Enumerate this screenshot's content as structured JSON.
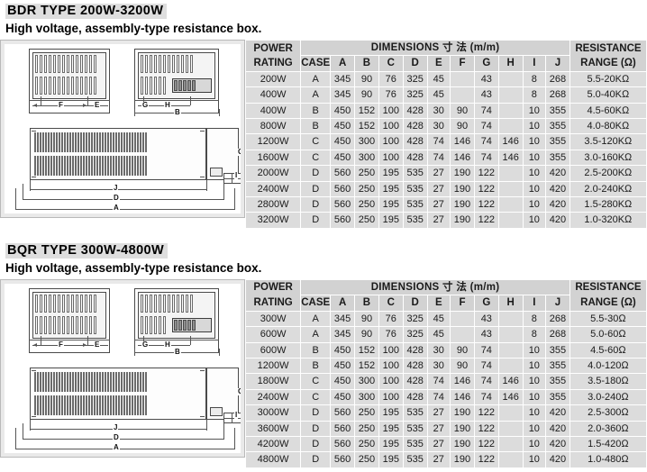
{
  "sections": [
    {
      "title": "BDR TYPE 200W-3200W",
      "subtitle": "High voltage, assembly-type resistance box.",
      "drawing": {
        "labels": {
          "f": "F",
          "e": "E",
          "g": "G",
          "h": "H",
          "b": "B",
          "j": "J",
          "d": "D",
          "a": "A",
          "c": "C",
          "i": "I"
        }
      },
      "table": {
        "header": {
          "power_rating": "POWER RATING",
          "power_rating_l1": "POWER",
          "power_rating_l2": "RATING",
          "dimensions": "DIMENSIONS 寸  法 (m/m)",
          "resistance": "RESISTANCE RANGE (Ω)",
          "resistance_l1": "RESISTANCE",
          "resistance_l2": "RANGE (Ω)",
          "columns": [
            "CASE",
            "A",
            "B",
            "C",
            "D",
            "E",
            "F",
            "G",
            "H",
            "I",
            "J"
          ]
        },
        "rows": [
          {
            "power": "200W",
            "case": "A",
            "a": "345",
            "b": "90",
            "c": "76",
            "d": "325",
            "e": "45",
            "f": "",
            "g": "43",
            "h": "",
            "i": "8",
            "j": "268",
            "res": "5.5-20KΩ"
          },
          {
            "power": "400W",
            "case": "A",
            "a": "345",
            "b": "90",
            "c": "76",
            "d": "325",
            "e": "45",
            "f": "",
            "g": "43",
            "h": "",
            "i": "8",
            "j": "268",
            "res": "5.0-40KΩ"
          },
          {
            "power": "400W",
            "case": "B",
            "a": "450",
            "b": "152",
            "c": "100",
            "d": "428",
            "e": "30",
            "f": "90",
            "g": "74",
            "h": "",
            "i": "10",
            "j": "355",
            "res": "4.5-60KΩ"
          },
          {
            "power": "800W",
            "case": "B",
            "a": "450",
            "b": "152",
            "c": "100",
            "d": "428",
            "e": "30",
            "f": "90",
            "g": "74",
            "h": "",
            "i": "10",
            "j": "355",
            "res": "4.0-80KΩ"
          },
          {
            "power": "1200W",
            "case": "C",
            "a": "450",
            "b": "300",
            "c": "100",
            "d": "428",
            "e": "74",
            "f": "146",
            "g": "74",
            "h": "146",
            "i": "10",
            "j": "355",
            "res": "3.5-120KΩ"
          },
          {
            "power": "1600W",
            "case": "C",
            "a": "450",
            "b": "300",
            "c": "100",
            "d": "428",
            "e": "74",
            "f": "146",
            "g": "74",
            "h": "146",
            "i": "10",
            "j": "355",
            "res": "3.0-160KΩ"
          },
          {
            "power": "2000W",
            "case": "D",
            "a": "560",
            "b": "250",
            "c": "195",
            "d": "535",
            "e": "27",
            "f": "190",
            "g": "122",
            "h": "",
            "i": "10",
            "j": "420",
            "res": "2.5-200KΩ"
          },
          {
            "power": "2400W",
            "case": "D",
            "a": "560",
            "b": "250",
            "c": "195",
            "d": "535",
            "e": "27",
            "f": "190",
            "g": "122",
            "h": "",
            "i": "10",
            "j": "420",
            "res": "2.0-240KΩ"
          },
          {
            "power": "2800W",
            "case": "D",
            "a": "560",
            "b": "250",
            "c": "195",
            "d": "535",
            "e": "27",
            "f": "190",
            "g": "122",
            "h": "",
            "i": "10",
            "j": "420",
            "res": "1.5-280KΩ"
          },
          {
            "power": "3200W",
            "case": "D",
            "a": "560",
            "b": "250",
            "c": "195",
            "d": "535",
            "e": "27",
            "f": "190",
            "g": "122",
            "h": "",
            "i": "10",
            "j": "420",
            "res": "1.0-320KΩ"
          }
        ]
      }
    },
    {
      "title": "BQR TYPE 300W-4800W",
      "subtitle": "High voltage, assembly-type resistance box.",
      "drawing": {
        "labels": {
          "f": "F",
          "e": "E",
          "g": "G",
          "h": "H",
          "b": "B",
          "j": "J",
          "d": "D",
          "a": "A",
          "c": "C",
          "i": "I"
        }
      },
      "table": {
        "header": {
          "power_rating": "POWER RATING",
          "power_rating_l1": "POWER",
          "power_rating_l2": "RATING",
          "dimensions": "DIMENSIONS 寸  法 (m/m)",
          "resistance": "RESISTANCE RANGE (Ω)",
          "resistance_l1": "RESISTANCE",
          "resistance_l2": "RANGE (Ω)",
          "columns": [
            "CASE",
            "A",
            "B",
            "C",
            "D",
            "E",
            "F",
            "G",
            "H",
            "I",
            "J"
          ]
        },
        "rows": [
          {
            "power": "300W",
            "case": "A",
            "a": "345",
            "b": "90",
            "c": "76",
            "d": "325",
            "e": "45",
            "f": "",
            "g": "43",
            "h": "",
            "i": "8",
            "j": "268",
            "res": "5.5-30Ω"
          },
          {
            "power": "600W",
            "case": "A",
            "a": "345",
            "b": "90",
            "c": "76",
            "d": "325",
            "e": "45",
            "f": "",
            "g": "43",
            "h": "",
            "i": "8",
            "j": "268",
            "res": "5.0-60Ω"
          },
          {
            "power": "600W",
            "case": "B",
            "a": "450",
            "b": "152",
            "c": "100",
            "d": "428",
            "e": "30",
            "f": "90",
            "g": "74",
            "h": "",
            "i": "10",
            "j": "355",
            "res": "4.5-60Ω"
          },
          {
            "power": "1200W",
            "case": "B",
            "a": "450",
            "b": "152",
            "c": "100",
            "d": "428",
            "e": "30",
            "f": "90",
            "g": "74",
            "h": "",
            "i": "10",
            "j": "355",
            "res": "4.0-120Ω"
          },
          {
            "power": "1800W",
            "case": "C",
            "a": "450",
            "b": "300",
            "c": "100",
            "d": "428",
            "e": "74",
            "f": "146",
            "g": "74",
            "h": "146",
            "i": "10",
            "j": "355",
            "res": "3.5-180Ω"
          },
          {
            "power": "2400W",
            "case": "C",
            "a": "450",
            "b": "300",
            "c": "100",
            "d": "428",
            "e": "74",
            "f": "146",
            "g": "74",
            "h": "146",
            "i": "10",
            "j": "355",
            "res": "3.0-240Ω"
          },
          {
            "power": "3000W",
            "case": "D",
            "a": "560",
            "b": "250",
            "c": "195",
            "d": "535",
            "e": "27",
            "f": "190",
            "g": "122",
            "h": "",
            "i": "10",
            "j": "420",
            "res": "2.5-300Ω"
          },
          {
            "power": "3600W",
            "case": "D",
            "a": "560",
            "b": "250",
            "c": "195",
            "d": "535",
            "e": "27",
            "f": "190",
            "g": "122",
            "h": "",
            "i": "10",
            "j": "420",
            "res": "2.0-360Ω"
          },
          {
            "power": "4200W",
            "case": "D",
            "a": "560",
            "b": "250",
            "c": "195",
            "d": "535",
            "e": "27",
            "f": "190",
            "g": "122",
            "h": "",
            "i": "10",
            "j": "420",
            "res": "1.5-420Ω"
          },
          {
            "power": "4800W",
            "case": "D",
            "a": "560",
            "b": "250",
            "c": "195",
            "d": "535",
            "e": "27",
            "f": "190",
            "g": "122",
            "h": "",
            "i": "10",
            "j": "420",
            "res": "1.0-480Ω"
          }
        ]
      }
    }
  ],
  "colors": {
    "table_header_bg": "#d2d2d2",
    "table_cell_bg": "#dcdcdc",
    "panel_bg": "#e9e9e9",
    "title_highlight": "#dedede",
    "line": "#555555"
  }
}
